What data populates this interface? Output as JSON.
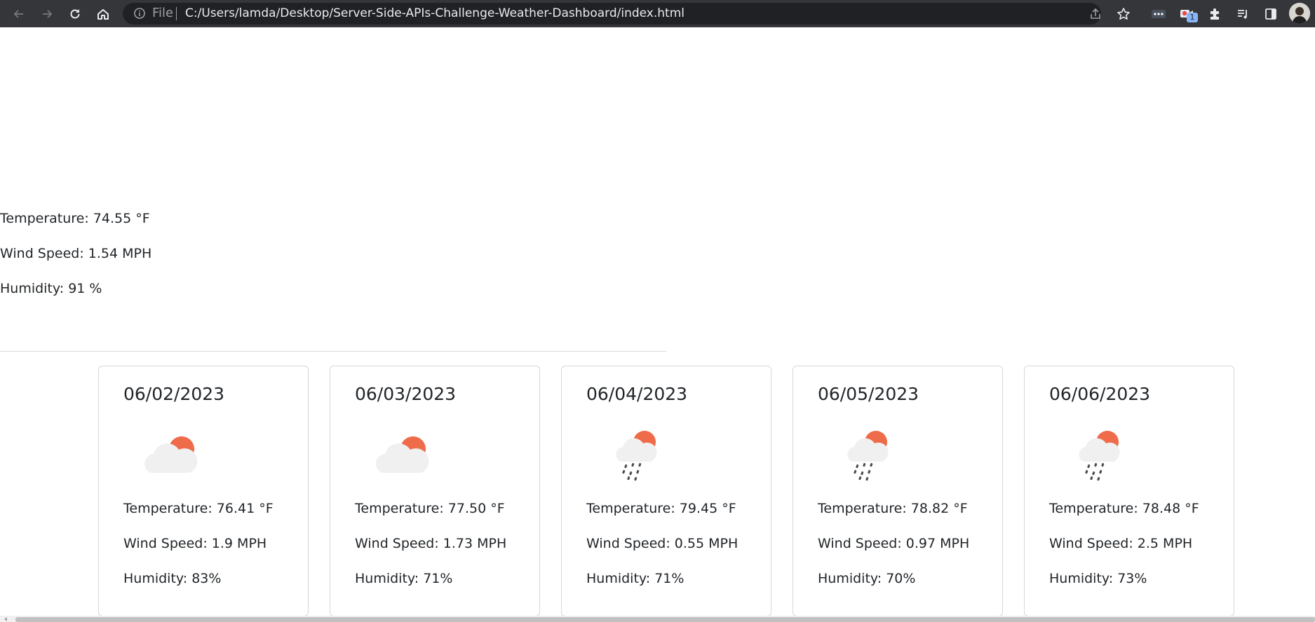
{
  "browser": {
    "file_label": "File",
    "url": "C:/Users/lamda/Desktop/Server-Side-APIs-Challenge-Weather-Dashboard/index.html",
    "extension_badge": "1",
    "colors": {
      "toolbar": "#35363a",
      "omnibox": "#202124",
      "url_text": "#e8eaed"
    }
  },
  "current": {
    "temperature": "Temperature: 74.55 °F",
    "wind": "Wind Speed: 1.54 MPH",
    "humidity": "Humidity: 91 %"
  },
  "forecast": [
    {
      "date": "06/02/2023",
      "icon": "partly-cloudy-sun-icon",
      "temperature": "Temperature: 76.41 °F",
      "wind": "Wind Speed: 1.9 MPH",
      "humidity": "Humidity: 83%"
    },
    {
      "date": "06/03/2023",
      "icon": "partly-cloudy-sun-icon",
      "temperature": "Temperature: 77.50 °F",
      "wind": "Wind Speed: 1.73 MPH",
      "humidity": "Humidity: 71%"
    },
    {
      "date": "06/04/2023",
      "icon": "rain-sun-icon",
      "temperature": "Temperature: 79.45 °F",
      "wind": "Wind Speed: 0.55 MPH",
      "humidity": "Humidity: 71%"
    },
    {
      "date": "06/05/2023",
      "icon": "rain-sun-icon",
      "temperature": "Temperature: 78.82 °F",
      "wind": "Wind Speed: 0.97 MPH",
      "humidity": "Humidity: 70%"
    },
    {
      "date": "06/06/2023",
      "icon": "rain-sun-icon",
      "temperature": "Temperature: 78.48 °F",
      "wind": "Wind Speed: 2.5 MPH",
      "humidity": "Humidity: 73%"
    }
  ],
  "icon_colors": {
    "sun": "#ef6c4a",
    "cloud": "#f0f0f0",
    "rain": "#4a4a4a"
  }
}
